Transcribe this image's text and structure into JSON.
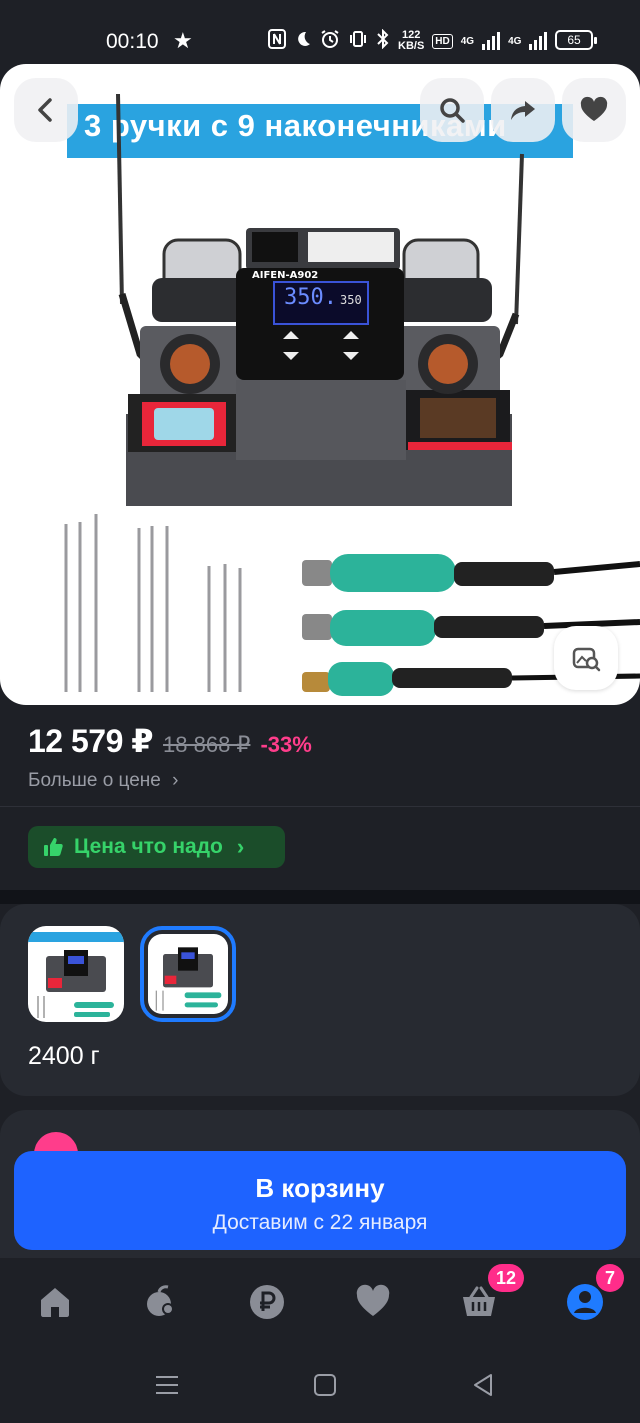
{
  "status_bar": {
    "time": "00:10",
    "speed_top": "122",
    "speed_bottom": "KB/S",
    "hd": "HD",
    "net1": "4G",
    "net2": "4G",
    "battery": "65"
  },
  "hero": {
    "banner_text": "3 ручки с 9 наконечниками",
    "station_brand": "AIFEN-A902",
    "display_main": "350.",
    "display_set": "350"
  },
  "price": {
    "current": "12 579 ₽",
    "old": "18 868 ₽",
    "discount": "-33%",
    "more_link": "Больше о цене",
    "badge_label": "Цена что надо"
  },
  "variants": {
    "weight": "2400 г",
    "selected_index": 1
  },
  "cart": {
    "title": "В корзину",
    "subtitle": "Доставим с 22 января"
  },
  "bottom_nav": {
    "items": [
      "home-icon",
      "catalog-icon",
      "ruble-icon",
      "favorites-icon",
      "cart-icon",
      "profile-icon"
    ],
    "cart_badge": "12",
    "profile_badge": "7"
  },
  "colors": {
    "background": "#1e2026",
    "accent": "#1e63ff",
    "discount": "#ff3d8b",
    "badge_green": "#36d36a"
  }
}
